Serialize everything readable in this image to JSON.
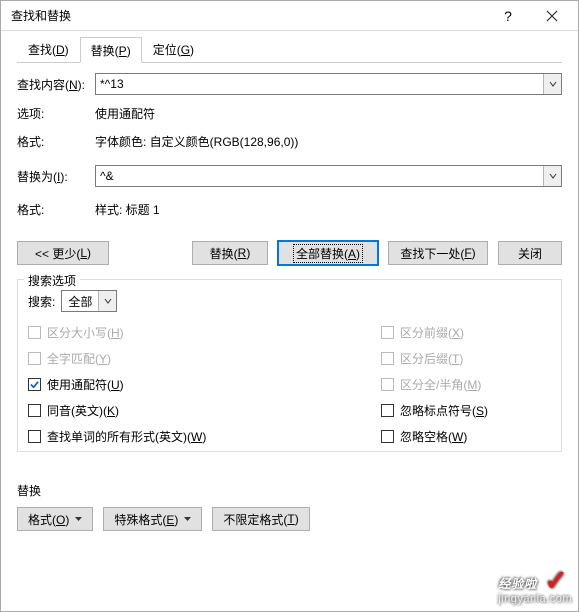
{
  "window": {
    "title": "查找和替换",
    "help_icon": "?",
    "close_icon": "×"
  },
  "tabs": {
    "find": {
      "text": "查找(",
      "key": "D",
      "suffix": ")"
    },
    "replace": {
      "text": "替换(",
      "key": "P",
      "suffix": ")"
    },
    "goto": {
      "text": "定位(",
      "key": "G",
      "suffix": ")"
    }
  },
  "form": {
    "find_label_pre": "查找内容(",
    "find_key": "N",
    "find_label_suf": "):",
    "find_value": "*^13",
    "options_label": "选项:",
    "options_value": "使用通配符",
    "format_label": "格式:",
    "format_value_find": "字体颜色: 自定义颜色(RGB(128,96,0))",
    "replace_label_pre": "替换为(",
    "replace_key": "I",
    "replace_label_suf": "):",
    "replace_value": "^&",
    "format_value_replace": "样式: 标题 1"
  },
  "buttons": {
    "less_pre": "<< 更少(",
    "less_key": "L",
    "less_suf": ")",
    "replace_pre": "替换(",
    "replace_key": "R",
    "replace_suf": ")",
    "replace_all_pre": "全部替换(",
    "replace_all_key": "A",
    "replace_all_suf": ")",
    "find_next_pre": "查找下一处(",
    "find_next_key": "F",
    "find_next_suf": ")",
    "close": "关闭"
  },
  "search_options": {
    "legend": "搜索选项",
    "search_label": "搜索:",
    "search_value": "全部",
    "left": [
      {
        "pre": "区分大小写(",
        "key": "H",
        "suf": ")",
        "disabled": true,
        "checked": false
      },
      {
        "pre": "全字匹配(",
        "key": "Y",
        "suf": ")",
        "disabled": true,
        "checked": false
      },
      {
        "pre": "使用通配符(",
        "key": "U",
        "suf": ")",
        "disabled": false,
        "checked": true
      },
      {
        "pre": "同音(英文)(",
        "key": "K",
        "suf": ")",
        "disabled": false,
        "checked": false
      },
      {
        "pre": "查找单词的所有形式(英文)(",
        "key": "W",
        "suf": ")",
        "disabled": false,
        "checked": false
      }
    ],
    "right": [
      {
        "pre": "区分前缀(",
        "key": "X",
        "suf": ")",
        "disabled": true,
        "checked": false
      },
      {
        "pre": "区分后缀(",
        "key": "T",
        "suf": ")",
        "disabled": true,
        "checked": false
      },
      {
        "pre": "区分全/半角(",
        "key": "M",
        "suf": ")",
        "disabled": true,
        "checked": false
      },
      {
        "pre": "忽略标点符号(",
        "key": "S",
        "suf": ")",
        "disabled": false,
        "checked": false
      },
      {
        "pre": "忽略空格(",
        "key": "W",
        "suf": ")",
        "disabled": false,
        "checked": false
      }
    ]
  },
  "replace_section": {
    "label": "替换",
    "format_pre": "格式(",
    "format_key": "O",
    "format_suf": ")",
    "special_pre": "特殊格式(",
    "special_key": "E",
    "special_suf": ")",
    "noformat_pre": "不限定格式(",
    "noformat_key": "T",
    "noformat_suf": ")"
  },
  "watermark": {
    "line1": "经验啦",
    "line2": "jingyanla.com"
  }
}
